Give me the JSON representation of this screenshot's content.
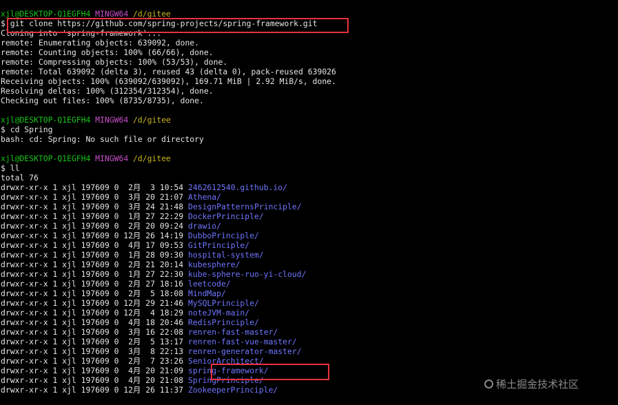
{
  "terminal": {
    "prompt_user": "xjl@DESKTOP-Q1EGFH4",
    "prompt_host": "MINGW64",
    "prompt_path": "/d/gitee"
  },
  "clone": {
    "command": "$ git clone https://github.com/spring-projects/spring-framework.git",
    "output": [
      "Cloning into 'spring-framework'...",
      "remote: Enumerating objects: 639092, done.",
      "remote: Counting objects: 100% (66/66), done.",
      "remote: Compressing objects: 100% (53/53), done.",
      "remote: Total 639092 (delta 3), reused 43 (delta 0), pack-reused 639026",
      "Receiving objects: 100% (639092/639092), 169.71 MiB | 2.92 MiB/s, done.",
      "Resolving deltas: 100% (312354/312354), done.",
      "Checking out files: 100% (8735/8735), done."
    ]
  },
  "cd": {
    "command": "$ cd Spring",
    "error": "bash: cd: Spring: No such file or directory"
  },
  "ll": {
    "command": "$ ll",
    "total": "total 76",
    "entries": [
      {
        "meta": "drwxr-xr-x 1 xjl 197609 0  2月  3 10:54",
        "name": "2462612540.github.io/"
      },
      {
        "meta": "drwxr-xr-x 1 xjl 197609 0  3月 20 21:07",
        "name": "Athena/"
      },
      {
        "meta": "drwxr-xr-x 1 xjl 197609 0  3月 24 21:48",
        "name": "DesignPatternsPrinciple/"
      },
      {
        "meta": "drwxr-xr-x 1 xjl 197609 0  1月 27 22:29",
        "name": "DockerPrinciple/"
      },
      {
        "meta": "drwxr-xr-x 1 xjl 197609 0  2月 20 09:24",
        "name": "drawio/"
      },
      {
        "meta": "drwxr-xr-x 1 xjl 197609 0 12月 26 14:19",
        "name": "DubboPrinciple/"
      },
      {
        "meta": "drwxr-xr-x 1 xjl 197609 0  4月 17 09:53",
        "name": "GitPrinciple/"
      },
      {
        "meta": "drwxr-xr-x 1 xjl 197609 0  1月 28 09:30",
        "name": "hospital-system/"
      },
      {
        "meta": "drwxr-xr-x 1 xjl 197609 0  2月 21 20:14",
        "name": "kubesphere/"
      },
      {
        "meta": "drwxr-xr-x 1 xjl 197609 0  1月 27 22:30",
        "name": "kube-sphere-ruo-yi-cloud/"
      },
      {
        "meta": "drwxr-xr-x 1 xjl 197609 0  2月 27 18:16",
        "name": "leetcode/"
      },
      {
        "meta": "drwxr-xr-x 1 xjl 197609 0  2月  5 18:08",
        "name": "MindMap/"
      },
      {
        "meta": "drwxr-xr-x 1 xjl 197609 0 12月 29 21:46",
        "name": "MySQLPrinciple/"
      },
      {
        "meta": "drwxr-xr-x 1 xjl 197609 0 12月  4 18:29",
        "name": "noteJVM-main/"
      },
      {
        "meta": "drwxr-xr-x 1 xjl 197609 0  4月 18 20:46",
        "name": "RedisPrinciple/"
      },
      {
        "meta": "drwxr-xr-x 1 xjl 197609 0  3月 16 22:08",
        "name": "renren-fast-master/"
      },
      {
        "meta": "drwxr-xr-x 1 xjl 197609 0  2月  5 13:17",
        "name": "renren-fast-vue-master/"
      },
      {
        "meta": "drwxr-xr-x 1 xjl 197609 0  3月  8 22:13",
        "name": "renren-generator-master/"
      },
      {
        "meta": "drwxr-xr-x 1 xjl 197609 0  2月  7 23:26",
        "name": "SeniorArchitect/"
      },
      {
        "meta": "drwxr-xr-x 1 xjl 197609 0  4月 20 21:09",
        "name": "spring-framework/"
      },
      {
        "meta": "drwxr-xr-x 1 xjl 197609 0  4月 20 21:08",
        "name": "SpringPrinciple/"
      },
      {
        "meta": "drwxr-xr-x 1 xjl 197609 0 12月 26 11:37",
        "name": "ZookeeperPrinciple/"
      }
    ]
  },
  "watermark": "稀土掘金技术社区",
  "colors": {
    "background": "#000000",
    "text": "#e6e6e6",
    "prompt_user": "#19c519",
    "prompt_host": "#c84fc8",
    "prompt_path": "#c8b41e",
    "directory": "#6f76ff",
    "highlight_box": "#e8323c"
  }
}
